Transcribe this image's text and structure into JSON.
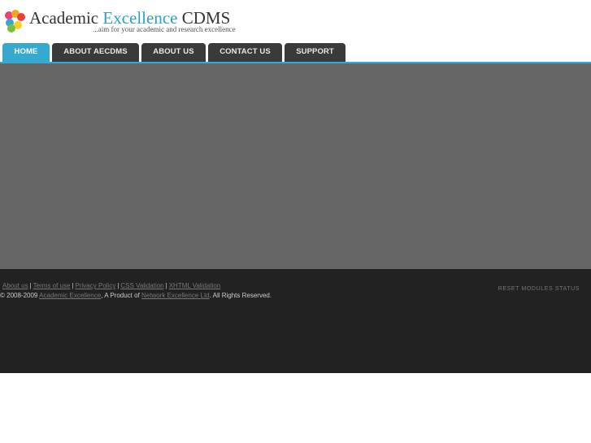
{
  "header": {
    "logo_title_main": "Academic ",
    "logo_title_accent": "Excellence",
    "logo_title_end": " CDMS",
    "tagline": "...aim for your academic and research excellence",
    "colors": {
      "accent": "#35a9d0",
      "nav_tab": "#3a3a3a",
      "main_bg": "#666666",
      "footer_bg": "#222222"
    }
  },
  "nav": {
    "tabs": [
      {
        "label": "HOME",
        "active": true
      },
      {
        "label": "ABOUT AECDMS",
        "active": false
      },
      {
        "label": "ABOUT US",
        "active": false
      },
      {
        "label": "CONTACT US",
        "active": false
      },
      {
        "label": "SUPPORT",
        "active": false
      }
    ]
  },
  "footer": {
    "links": [
      "About us",
      "Terms of use",
      "Privacy Policy",
      "CSS Validation",
      "XHTML Validation"
    ],
    "separator": "|",
    "copyright_prefix": "© 2008-2009 ",
    "copyright_link1": "Academic Excellence",
    "copyright_mid": ", A Product of ",
    "copyright_link2": "Network Excellence Ltd",
    "copyright_suffix": ". All Rights Reserved.",
    "reset_label": "RESET MODULES STATUS"
  }
}
